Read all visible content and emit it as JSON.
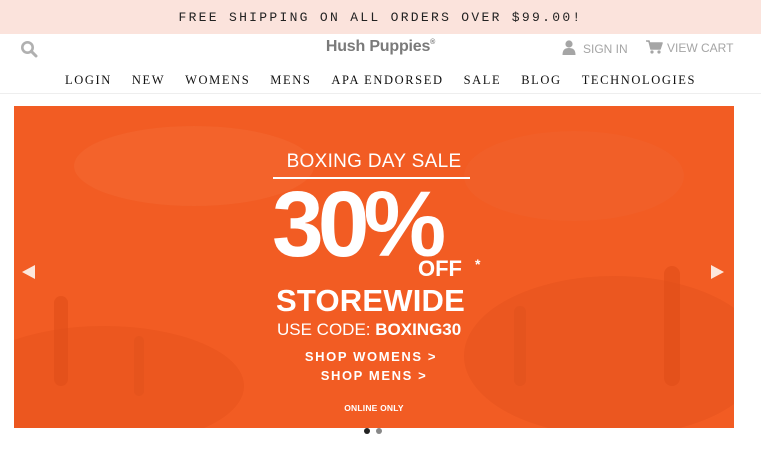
{
  "promo": {
    "text": "FREE SHIPPING ON ALL ORDERS OVER $99.00!"
  },
  "header": {
    "search_icon": "search-icon",
    "logo_text": "Hush Puppies",
    "logo_mark": "®",
    "signin_label": "SIGN IN",
    "signin_icon": "user-icon",
    "cart_label": "VIEW CART",
    "cart_icon": "cart-icon"
  },
  "nav": {
    "items": [
      {
        "label": "LOGIN"
      },
      {
        "label": "NEW"
      },
      {
        "label": "WOMENS"
      },
      {
        "label": "MENS"
      },
      {
        "label": "APA ENDORSED"
      },
      {
        "label": "SALE"
      },
      {
        "label": "BLOG"
      },
      {
        "label": "TECHNOLOGIES"
      }
    ]
  },
  "hero": {
    "title": "BOXING DAY SALE",
    "percent": "30%",
    "off": "OFF",
    "asterisk": "*",
    "storewide": "STOREWIDE",
    "code_prefix": "USE CODE: ",
    "code": "BOXING30",
    "link_women": "SHOP WOMENS >",
    "link_men": "SHOP MENS >",
    "online_only": "ONLINE ONLY",
    "bg_color": "#f25c23",
    "prev_icon": "arrow-left-icon",
    "next_icon": "arrow-right-icon"
  },
  "carousel": {
    "slides": 2,
    "active": 1
  },
  "colors": {
    "promo_bg": "#fbe3dc",
    "hero": "#f25c23",
    "muted": "#a5a5a5"
  }
}
